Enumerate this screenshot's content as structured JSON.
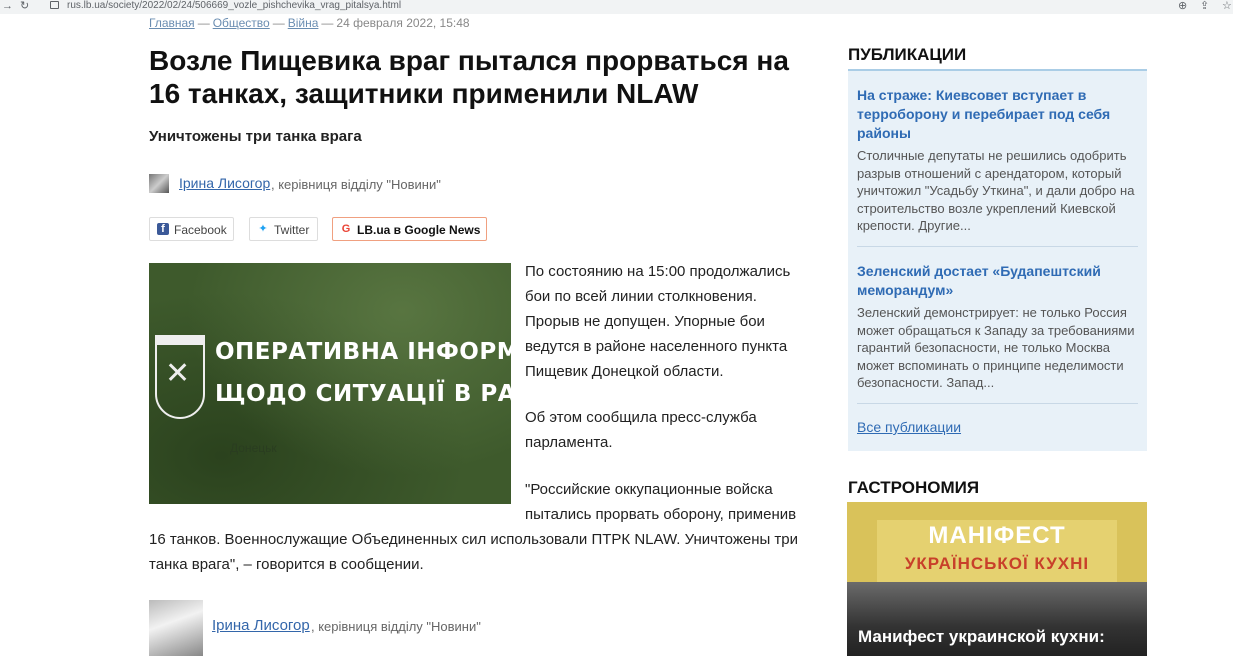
{
  "browser": {
    "url": "rus.lb.ua/society/2022/02/24/506669_vozle_pishchevika_vrag_pitalsya.html"
  },
  "breadcrumb": {
    "items": [
      "Главная",
      "Общество",
      "Війна"
    ],
    "separator": "—",
    "date": "24 февраля 2022, 15:48"
  },
  "article": {
    "headline": "Возле Пищевика враг пытался прорваться на 16 танках, защитники применили NLAW",
    "subtitle": "Уничтожены три танка врага",
    "author": {
      "name": "Ірина Лисогор",
      "role": ", керівниця відділу \"Новини\""
    },
    "share": {
      "facebook": "Facebook",
      "twitter": "Twitter",
      "google_news": "LB.ua в Google News"
    },
    "image": {
      "line1": "ОПЕРАТИВНА ІНФОРМАЦІЯ",
      "line2": "ЩОДО СИТУАЦІЇ В РАЙОНІ ООС",
      "city": "Донецьк"
    },
    "paragraphs": {
      "p1": "По состоянию на 15:00 продолжались бои по всей линии столкновения. Прорыв не допущен. Упорные бои ведутся в районе населенного пункта Пищевик Донецкой области.",
      "p2": "Об этом сообщила пресс-служба парламента.",
      "p3a": "\"Российские оккупационные войска пытались прорвать оборону, применив",
      "p3b": "16 танков. Военнослужащие Объединенных сил использовали ПТРК NLAW. Уничтожены три танка врага\", – говорится в сообщении."
    }
  },
  "sidebar": {
    "publications": {
      "heading": "ПУБЛИКАЦИИ",
      "items": [
        {
          "title": "На страже: Киевсовет вступает в терроборону и перебирает под себя районы",
          "desc": "Столичные депутаты не решились одобрить разрыв отношений с арендатором, который уничтожил \"Усадьбу Уткина\", и дали добро на строительство возле укреплений Киевской крепости. Другие..."
        },
        {
          "title": "Зеленский достает «Будапештский меморандум»",
          "desc": "Зеленский демонстрирует: не только Россия может обращаться к Западу за требованиями гарантий безопасности, не только Москва может вспоминать о принципе неделимости безопасности. Запад..."
        }
      ],
      "all_link": "Все публикации"
    },
    "gastronomy": {
      "heading": "ГАСТРОНОМИЯ",
      "banner_line1": "МАНІФЕСТ",
      "banner_line2": "УКРАЇНСЬКОЇ КУХНІ",
      "caption": "Манифест украинской кухни:"
    }
  }
}
